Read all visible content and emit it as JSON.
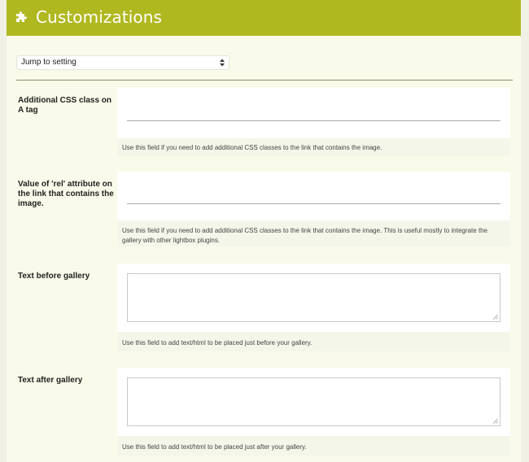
{
  "header": {
    "title": "Customizations",
    "icon": "puzzle-icon",
    "color": "#b0b820"
  },
  "jump": {
    "label": "Jump to setting"
  },
  "settings": [
    {
      "label": "Additional CSS class on A tag",
      "field_type": "text",
      "value": "",
      "help": "Use this field if you need to add additional CSS classes to the link that contains the image."
    },
    {
      "label": "Value of 'rel' attribute on the link that contains the image.",
      "field_type": "text",
      "value": "",
      "help": "Use this field if you need to add additional CSS classes to the link that contains the image. This is useful mostly to integrate the gallery with other lightbox plugins."
    },
    {
      "label": "Text before gallery",
      "field_type": "textarea",
      "value": "",
      "help": "Use this field to add text/html to be placed just before your gallery."
    },
    {
      "label": "Text after gallery",
      "field_type": "textarea",
      "value": "",
      "help": "Use this field to add text/html to be placed just after your gallery."
    }
  ]
}
